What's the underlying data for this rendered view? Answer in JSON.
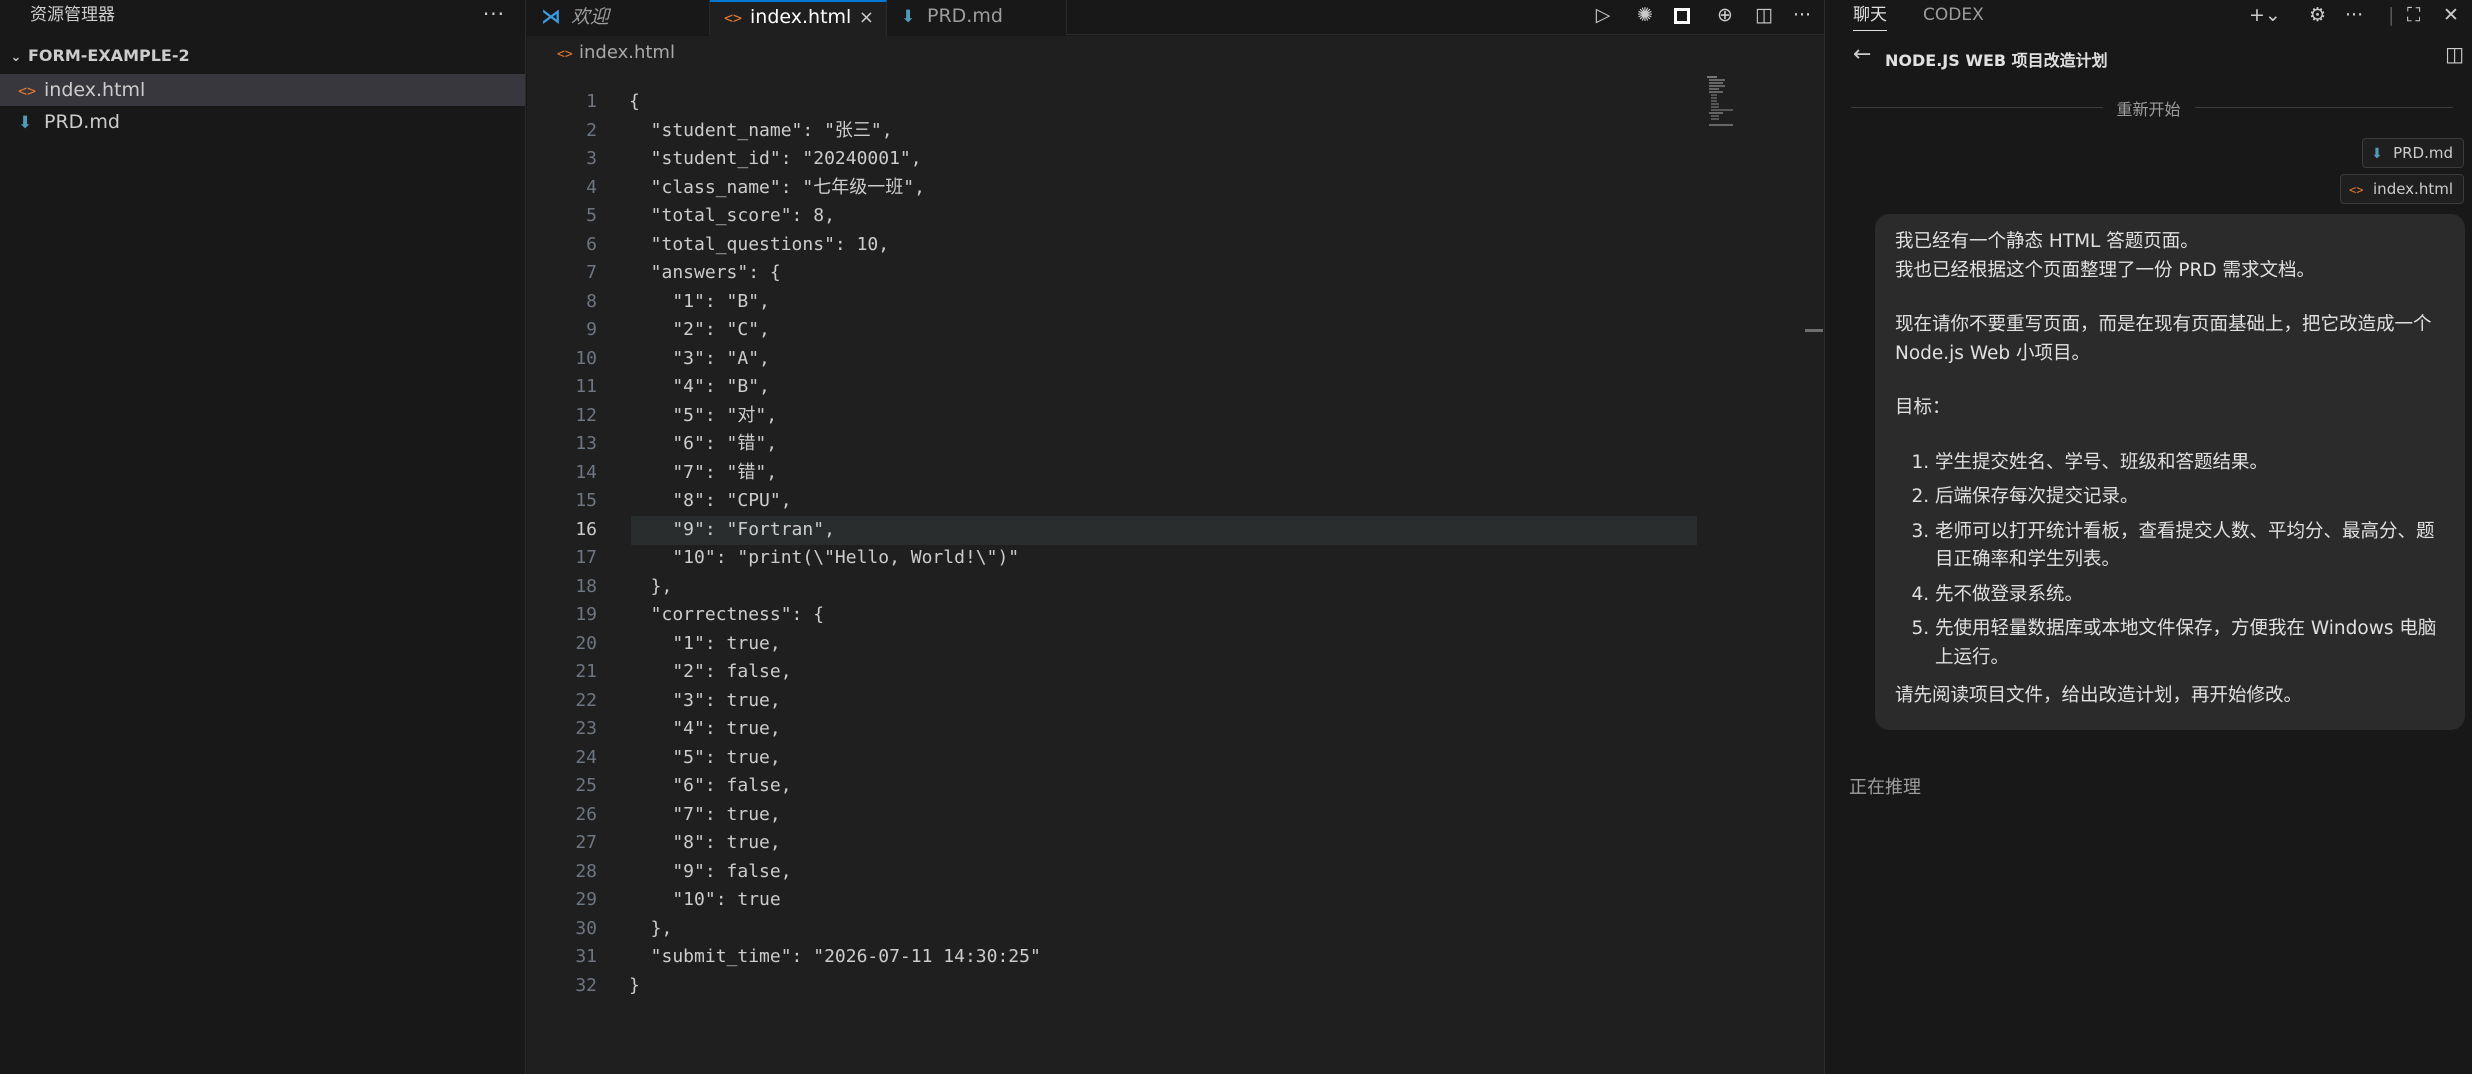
{
  "explorer": {
    "header": "资源管理器",
    "more": "···",
    "folder": "FORM-EXAMPLE-2",
    "files": [
      {
        "name": "index.html",
        "icon": "html-file-icon",
        "active": true
      },
      {
        "name": "PRD.md",
        "icon": "markdown-file-icon",
        "active": false
      }
    ]
  },
  "tabs": {
    "welcome": "欢迎",
    "index": "index.html",
    "prd": "PRD.md",
    "close": "×"
  },
  "breadcrumb": {
    "file": "index.html"
  },
  "editor": {
    "current_line": 16,
    "lines": [
      "{",
      "  \"student_name\": \"张三\",",
      "  \"student_id\": \"20240001\",",
      "  \"class_name\": \"七年级一班\",",
      "  \"total_score\": 8,",
      "  \"total_questions\": 10,",
      "  \"answers\": {",
      "    \"1\": \"B\",",
      "    \"2\": \"C\",",
      "    \"3\": \"A\",",
      "    \"4\": \"B\",",
      "    \"5\": \"对\",",
      "    \"6\": \"错\",",
      "    \"7\": \"错\",",
      "    \"8\": \"CPU\",",
      "    \"9\": \"Fortran\",",
      "    \"10\": \"print(\\\"Hello, World!\\\")\"",
      "  },",
      "  \"correctness\": {",
      "    \"1\": true,",
      "    \"2\": false,",
      "    \"3\": true,",
      "    \"4\": true,",
      "    \"5\": true,",
      "    \"6\": false,",
      "    \"7\": true,",
      "    \"8\": true,",
      "    \"9\": false,",
      "    \"10\": true",
      "  },",
      "  \"submit_time\": \"2026-07-11 14:30:25\"",
      "}"
    ]
  },
  "chat": {
    "tab_chat": "聊天",
    "tab_codex": "CODEX",
    "thread_title": "NODE.JS WEB 项目改造计划",
    "restart": "重新开始",
    "attachments": [
      "PRD.md",
      "index.html"
    ],
    "message": {
      "p1": "我已经有一个静态 HTML 答题页面。",
      "p2": "我也已经根据这个页面整理了一份 PRD 需求文档。",
      "p3": "现在请你不要重写页面，而是在现有页面基础上，把它改造成一个 Node.js Web 小项目。",
      "p4": "目标：",
      "items": [
        "学生提交姓名、学号、班级和答题结果。",
        "后端保存每次提交记录。",
        "老师可以打开统计看板，查看提交人数、平均分、最高分、题目正确率和学生列表。",
        "先不做登录系统。",
        "先使用轻量数据库或本地文件保存，方便我在 Windows 电脑上运行。"
      ],
      "p5": "请先阅读项目文件，给出改造计划，再开始修改。"
    },
    "status": "正在推理"
  },
  "colors": {
    "accent": "#0078d4",
    "html_icon": "#e37933",
    "md_icon": "#519aba"
  }
}
